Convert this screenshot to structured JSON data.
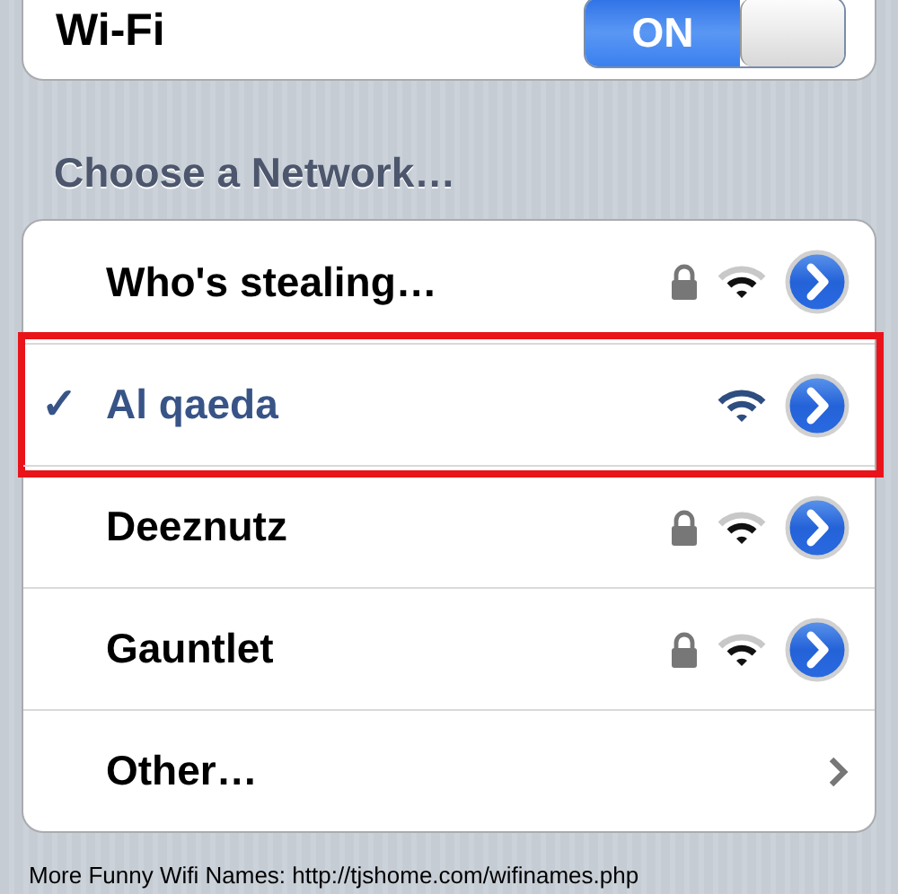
{
  "wifi": {
    "label": "Wi-Fi",
    "toggle_text": "ON",
    "on": true
  },
  "section_title": "Choose a Network…",
  "networks": [
    {
      "kind": "network",
      "name": "Who's stealing…",
      "selected": false,
      "secured": true,
      "full_signal": false,
      "highlighted": false
    },
    {
      "kind": "network",
      "name": "Al qaeda",
      "selected": true,
      "secured": false,
      "full_signal": true,
      "highlighted": true
    },
    {
      "kind": "network",
      "name": "Deeznutz",
      "selected": false,
      "secured": true,
      "full_signal": false,
      "highlighted": false
    },
    {
      "kind": "network",
      "name": "Gauntlet",
      "selected": false,
      "secured": true,
      "full_signal": false,
      "highlighted": false
    },
    {
      "kind": "other",
      "name": "Other…",
      "selected": false
    }
  ],
  "check_mark": "✓",
  "caption": "More Funny Wifi Names: http://tjshome.com/wifinames.php"
}
